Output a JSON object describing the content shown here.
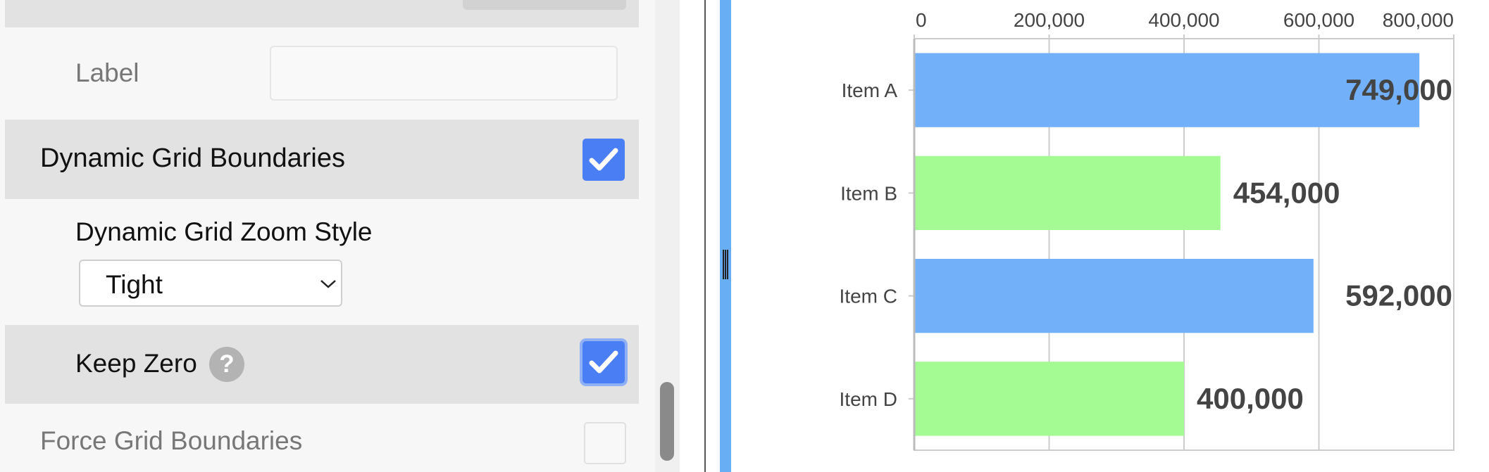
{
  "settings": {
    "label": {
      "text": "Label",
      "input_value": ""
    },
    "dynamic_grid_boundaries": {
      "text": "Dynamic Grid Boundaries",
      "checked": true
    },
    "dynamic_grid_zoom_style": {
      "text": "Dynamic Grid Zoom Style",
      "value": "Tight"
    },
    "keep_zero": {
      "text": "Keep Zero",
      "help_symbol": "?",
      "checked": true
    },
    "force_grid_boundaries": {
      "text": "Force Grid Boundaries",
      "checked": false
    }
  },
  "colors": {
    "checkbox_accent": "#4a7ef5",
    "series_blue": "#72b1f9",
    "series_green": "#a4fa93",
    "splitter": "#67aef5"
  },
  "chart_data": {
    "type": "bar",
    "orientation": "horizontal",
    "categories": [
      "Item A",
      "Item B",
      "Item C",
      "Item D"
    ],
    "values": [
      749000,
      454000,
      592000,
      400000
    ],
    "value_labels": [
      "749,000",
      "454,000",
      "592,000",
      "400,000"
    ],
    "bar_colors": [
      "#72b1f9",
      "#a4fa93",
      "#72b1f9",
      "#a4fa93"
    ],
    "x_ticks": [
      0,
      200000,
      400000,
      600000,
      800000
    ],
    "x_tick_labels": [
      "0",
      "200,000",
      "400,000",
      "600,000",
      "800,000"
    ],
    "xlim": [
      0,
      800000
    ],
    "x_axis_position": "top",
    "grid": true
  }
}
